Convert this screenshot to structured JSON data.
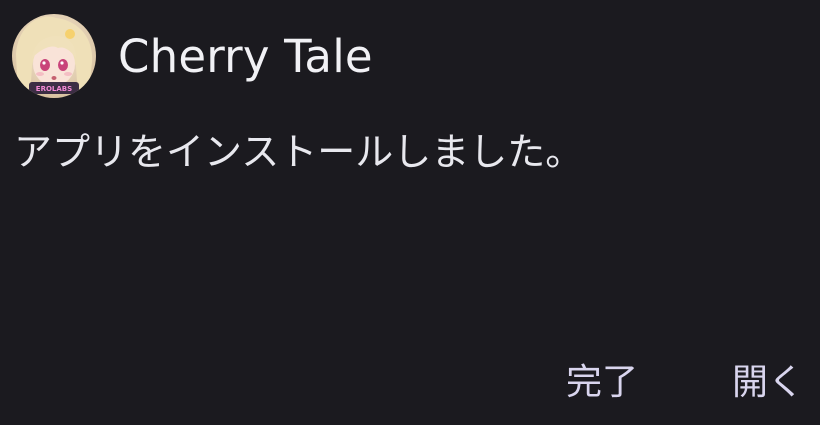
{
  "app": {
    "name": "Cherry Tale",
    "icon": "anime-character-app-icon",
    "icon_badge_text": "EROLABS"
  },
  "dialog": {
    "message": "アプリをインストールしました。"
  },
  "actions": {
    "done_label": "完了",
    "open_label": "開く"
  },
  "colors": {
    "background": "#1b1a1f",
    "text": "#ececf1",
    "action_text": "#d9d5ee"
  }
}
